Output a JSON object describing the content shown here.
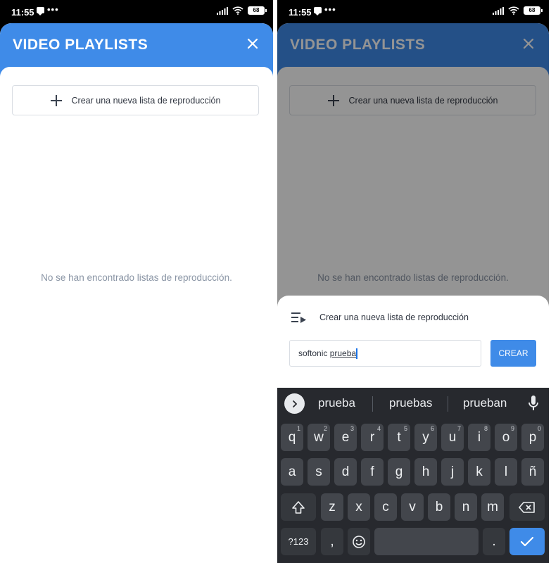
{
  "status_bar": {
    "time": "11:55",
    "battery": "68"
  },
  "header": {
    "title": "VIDEO PLAYLISTS"
  },
  "create_button": {
    "label": "Crear una nueva lista de reproducción"
  },
  "empty_message": "No se han encontrado listas de reproducción.",
  "dialog": {
    "title": "Crear una nueva lista de reproducción",
    "input_value_prefix": "softonic ",
    "input_value_word": "prueba",
    "submit_label": "CREAR"
  },
  "keyboard": {
    "suggestions": [
      "prueba",
      "pruebas",
      "prueban"
    ],
    "row1": [
      {
        "k": "q",
        "s": "1"
      },
      {
        "k": "w",
        "s": "2"
      },
      {
        "k": "e",
        "s": "3"
      },
      {
        "k": "r",
        "s": "4"
      },
      {
        "k": "t",
        "s": "5"
      },
      {
        "k": "y",
        "s": "6"
      },
      {
        "k": "u",
        "s": "7"
      },
      {
        "k": "i",
        "s": "8"
      },
      {
        "k": "o",
        "s": "9"
      },
      {
        "k": "p",
        "s": "0"
      }
    ],
    "row2": [
      "a",
      "s",
      "d",
      "f",
      "g",
      "h",
      "j",
      "k",
      "l",
      "ñ"
    ],
    "row3": [
      "z",
      "x",
      "c",
      "v",
      "b",
      "n",
      "m"
    ],
    "symbols_label": "?123",
    "comma_label": ",",
    "period_label": "."
  },
  "colors": {
    "accent": "#3f8be8",
    "keyboard_bg": "#27292e",
    "key_bg": "#43464c"
  }
}
